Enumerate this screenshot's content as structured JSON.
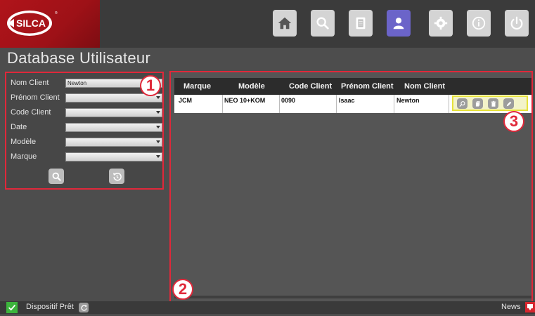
{
  "header": {
    "logo_text": "SILCA",
    "nav": [
      {
        "name": "home-icon"
      },
      {
        "name": "search-icon"
      },
      {
        "name": "database-icon"
      },
      {
        "name": "user-icon",
        "active": true
      },
      {
        "name": "gear-icon"
      },
      {
        "name": "info-icon"
      },
      {
        "name": "power-icon"
      }
    ],
    "active_color": "#6b64c9"
  },
  "page_title": "Database Utilisateur",
  "filters": {
    "fields": [
      {
        "label": "Nom Client",
        "value": "Newton"
      },
      {
        "label": "Prénom Client",
        "value": ""
      },
      {
        "label": "Code Client",
        "value": ""
      },
      {
        "label": "Date",
        "value": ""
      },
      {
        "label": "Modèle",
        "value": ""
      },
      {
        "label": "Marque",
        "value": ""
      }
    ],
    "buttons": [
      "search-icon",
      "reset-icon"
    ]
  },
  "badges": [
    "1",
    "2",
    "3"
  ],
  "table": {
    "columns": [
      "Marque",
      "Modèle",
      "Code Client",
      "Prénom Client",
      "Nom Client"
    ],
    "rows": [
      {
        "marque": "JCM",
        "modele": "NEO 10+KOM",
        "code": "0090",
        "prenom": "Isaac",
        "nom": "Newton"
      }
    ],
    "row_actions": [
      "zoom-icon",
      "copy-icon",
      "delete-icon",
      "edit-icon"
    ]
  },
  "status": {
    "text": "Dispositif Prêt",
    "news": "News"
  },
  "colors": {
    "highlight_red": "#e0283a",
    "highlight_yellow": "#e6e23a",
    "ok_green": "#3cb43c"
  }
}
